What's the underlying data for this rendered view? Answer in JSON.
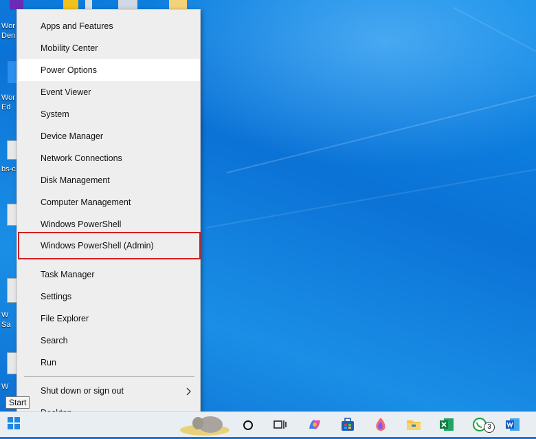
{
  "desktop": {
    "icon_labels": [
      "Wor",
      "Den",
      "Wor",
      "Ed",
      "bs-c",
      "W",
      "Sa",
      "W"
    ]
  },
  "menu": {
    "items": [
      {
        "label": "Apps and Features"
      },
      {
        "label": "Mobility Center"
      },
      {
        "label": "Power Options"
      },
      {
        "label": "Event Viewer"
      },
      {
        "label": "System"
      },
      {
        "label": "Device Manager"
      },
      {
        "label": "Network Connections"
      },
      {
        "label": "Disk Management"
      },
      {
        "label": "Computer Management"
      },
      {
        "label": "Windows PowerShell"
      },
      {
        "label": "Windows PowerShell (Admin)"
      },
      {
        "label": "Task Manager"
      },
      {
        "label": "Settings"
      },
      {
        "label": "File Explorer"
      },
      {
        "label": "Search"
      },
      {
        "label": "Run"
      },
      {
        "label": "Shut down or sign out",
        "submenu_icon": "chevron-right-icon"
      },
      {
        "label": "Desktop"
      }
    ],
    "hovered": "Power Options",
    "highlighted": "Windows PowerShell (Admin)",
    "highlight_color": "#d21f1f"
  },
  "taskbar": {
    "start_tooltip": "Start",
    "icons": [
      "start-icon",
      "search-circle-icon",
      "task-view-icon",
      "copilot-icon",
      "store-icon",
      "edge-dev-icon",
      "file-explorer-icon",
      "excel-icon",
      "whatsapp-icon",
      "word-icon"
    ],
    "whatsapp_badge": "3"
  }
}
